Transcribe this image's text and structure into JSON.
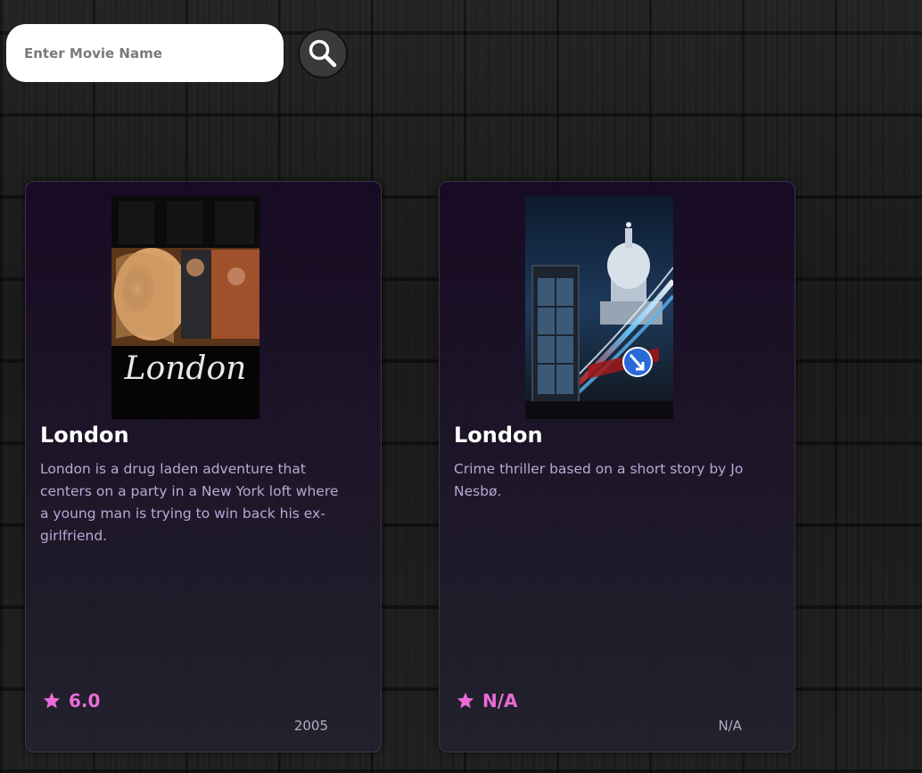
{
  "search": {
    "placeholder": "Enter Movie Name",
    "button_icon": "search-icon"
  },
  "colors": {
    "rating_accent": "#ec6bd8",
    "description_text": "#b8a9d4",
    "card_background": "#1c1228"
  },
  "movies": [
    {
      "title": "London",
      "description": "London is a drug laden adventure that centers on a party in a New York loft where a young man is trying to win back his ex-girlfriend.",
      "rating": "6.0",
      "rating_icon": "star-icon",
      "year": "2005",
      "poster_text": "London"
    },
    {
      "title": "London",
      "description": "Crime thriller based on a short story by Jo Nesbø.",
      "rating": "N/A",
      "rating_icon": "star-icon",
      "year": "N/A"
    }
  ]
}
